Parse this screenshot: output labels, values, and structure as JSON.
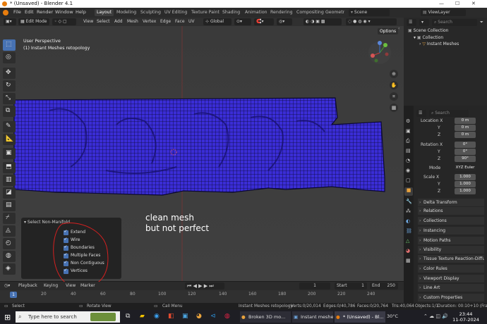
{
  "window": {
    "title": "* (Unsaved) - Blender 4.1"
  },
  "menu": {
    "items": [
      "File",
      "Edit",
      "Render",
      "Window",
      "Help"
    ]
  },
  "workspaces": {
    "tabs": [
      "Layout",
      "Modeling",
      "Sculpting",
      "UV Editing",
      "Texture Paint",
      "Shading",
      "Animation",
      "Rendering",
      "Compositing",
      "Geometr"
    ],
    "active": "Layout",
    "scene": "Scene",
    "view_layer": "ViewLayer"
  },
  "header": {
    "mode": "Edit Mode",
    "menus": [
      "View",
      "Select",
      "Add",
      "Mesh",
      "Vertex",
      "Edge",
      "Face",
      "UV"
    ],
    "orientation": "Global",
    "options": "Options"
  },
  "viewport": {
    "view_name": "User Perspective",
    "object_name": "(1) Instant Meshes retopology",
    "mesh_color": "#3a2dd6",
    "annotation": [
      "clean mesh",
      "but not perfect"
    ]
  },
  "redo_panel": {
    "title": "Select Non-Manifold",
    "options": [
      "Extend",
      "Wire",
      "Boundaries",
      "Multiple Faces",
      "Non Contiguous",
      "Vertices"
    ]
  },
  "timeline": {
    "menus": [
      "Playback",
      "Keying",
      "View",
      "Marker"
    ],
    "current_frame": "1",
    "start_label": "Start",
    "start": "1",
    "end_label": "End",
    "end": "250",
    "frame_ticks": [
      "1",
      "20",
      "40",
      "60",
      "80",
      "100",
      "120",
      "140",
      "160",
      "180",
      "200",
      "220",
      "240"
    ]
  },
  "statusbar": {
    "left_hints": [
      "Select",
      "Rotate View",
      "Call Menu"
    ],
    "object": "Instant Meshes retopology",
    "verts": "Verts:0/20,014",
    "edges": "Edges:0/40,786",
    "faces": "Faces:0/20,764",
    "tris": "Tris:40,064",
    "objects": "Objects:1/1",
    "duration": "Duration: 00:10+10 (Fra"
  },
  "outliner": {
    "search_placeholder": "Search",
    "root": "Scene Collection",
    "collection": "Collection",
    "object": "Instant Meshes"
  },
  "properties": {
    "search_placeholder": "Search",
    "location": {
      "label": "Location X",
      "x": "0 m",
      "y": "0 m",
      "z": "0 m"
    },
    "rotation": {
      "label": "Rotation X",
      "x": "0°",
      "y": "0°",
      "z": "90°"
    },
    "mode_label": "Mode",
    "mode_value": "XYZ Euler",
    "scale": {
      "label": "Scale X",
      "x": "1.000",
      "y": "1.000",
      "z": "1.000"
    },
    "axis_y": "Y",
    "axis_z": "Z",
    "panels": [
      "Delta Transform",
      "Relations",
      "Collections",
      "Instancing",
      "Motion Paths",
      "Visibility",
      "Tissue Texture Reaction-Diffusi",
      "Color Rules",
      "Viewport Display",
      "Line Art",
      "Custom Properties"
    ]
  },
  "taskbar": {
    "search": "Type here to search",
    "apps": [
      "Broken 3D mo...",
      "Instant meshes",
      "* (Unsaved) - Bl..."
    ],
    "time": "23:44",
    "date": "11-07-2024",
    "temp": "30°C"
  },
  "colors": {
    "accent": "#4772b3",
    "mesh": "#3a2dd6",
    "annotation_circle": "#d42020"
  }
}
